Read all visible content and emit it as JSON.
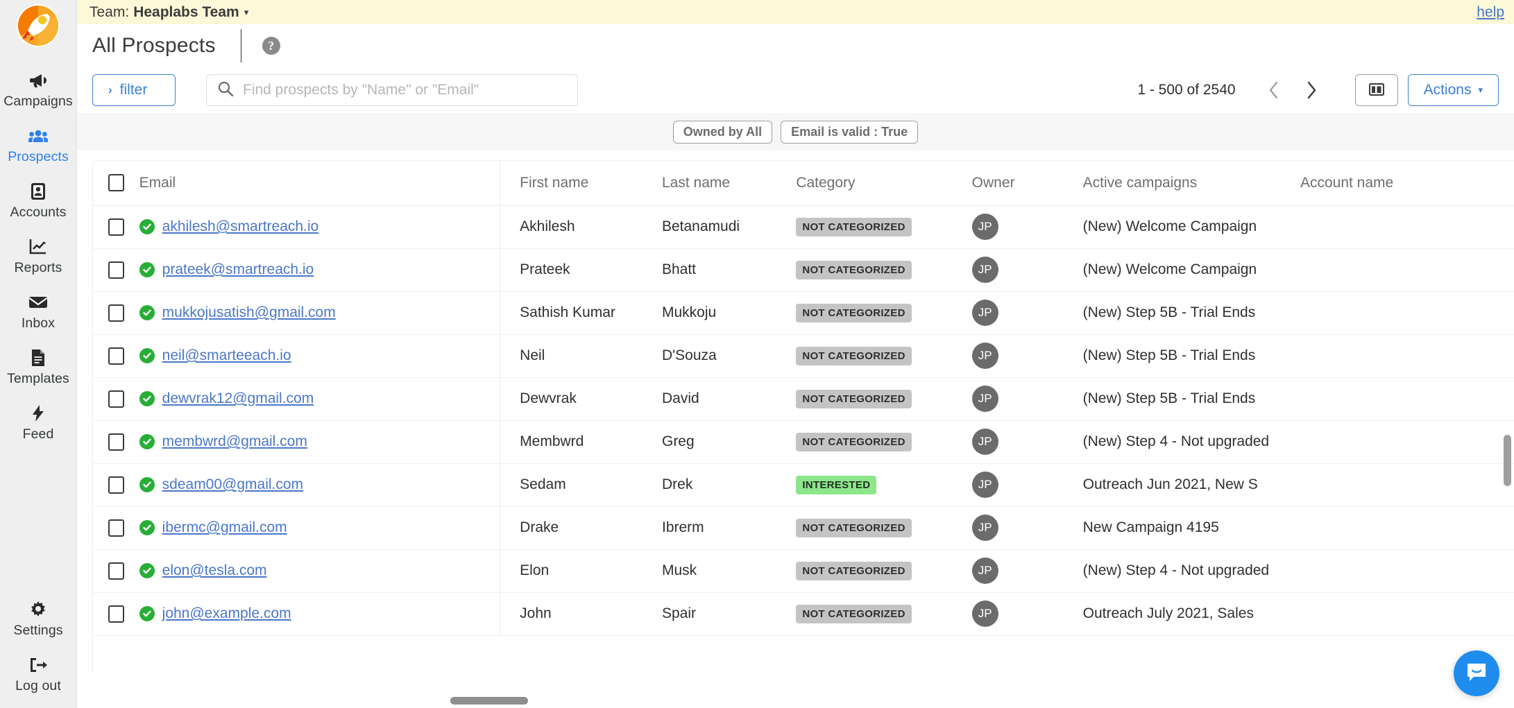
{
  "sidebar": {
    "logo_name": "rocket-logo",
    "top_items": [
      {
        "label": "Campaigns",
        "icon": "megaphone-icon",
        "active": false
      },
      {
        "label": "Prospects",
        "icon": "people-icon",
        "active": true
      },
      {
        "label": "Accounts",
        "icon": "id-card-icon",
        "active": false
      },
      {
        "label": "Reports",
        "icon": "chart-icon",
        "active": false
      },
      {
        "label": "Inbox",
        "icon": "envelope-icon",
        "active": false
      },
      {
        "label": "Templates",
        "icon": "document-icon",
        "active": false
      },
      {
        "label": "Feed",
        "icon": "bolt-icon",
        "active": false
      }
    ],
    "bottom_items": [
      {
        "label": "Settings",
        "icon": "gear-icon",
        "active": false
      },
      {
        "label": "Log out",
        "icon": "logout-icon",
        "active": false
      }
    ]
  },
  "teambar": {
    "prefix": "Team:",
    "team_name": "Heaplabs Team",
    "caret": "▾",
    "help_label": "help"
  },
  "header": {
    "title": "All Prospects",
    "help_icon_label": "?"
  },
  "toolbar": {
    "filter_label": "filter",
    "filter_chevron": "›",
    "search_placeholder": "Find prospects by \"Name\" or \"Email\"",
    "search_value": "",
    "pagination_text": "1 - 500 of 2540",
    "prev_label": "‹",
    "next_label": "›",
    "columns_button_name": "column-settings-button",
    "actions_label": "Actions",
    "actions_caret": "▾"
  },
  "filter_chips": [
    {
      "label": "Owned by All"
    },
    {
      "label": "Email is valid : True"
    }
  ],
  "table": {
    "columns": [
      "Email",
      "First name",
      "Last name",
      "Category",
      "Owner",
      "Active campaigns",
      "Account name"
    ],
    "rows": [
      {
        "email": "akhilesh@smartreach.io",
        "first_name": "Akhilesh",
        "last_name": "Betanamudi",
        "category": "NOT CATEGORIZED",
        "category_tone": "gray",
        "owner": "JP",
        "active_campaigns": "(New) Welcome Campaign",
        "account_name": ""
      },
      {
        "email": "prateek@smartreach.io",
        "first_name": "Prateek",
        "last_name": "Bhatt",
        "category": "NOT CATEGORIZED",
        "category_tone": "gray",
        "owner": "JP",
        "active_campaigns": "(New) Welcome Campaign",
        "account_name": ""
      },
      {
        "email": "mukkojusatish@gmail.com",
        "first_name": "Sathish Kumar",
        "last_name": "Mukkoju",
        "category": "NOT CATEGORIZED",
        "category_tone": "gray",
        "owner": "JP",
        "active_campaigns": "(New) Step 5B - Trial Ends",
        "account_name": ""
      },
      {
        "email": "neil@smarteeach.io",
        "first_name": "Neil",
        "last_name": "D'Souza",
        "category": "NOT CATEGORIZED",
        "category_tone": "gray",
        "owner": "JP",
        "active_campaigns": "(New) Step 5B - Trial Ends",
        "account_name": ""
      },
      {
        "email": "dewvrak12@gmail.com",
        "first_name": "Dewvrak",
        "last_name": "David",
        "category": "NOT CATEGORIZED",
        "category_tone": "gray",
        "owner": "JP",
        "active_campaigns": "(New) Step 5B - Trial Ends",
        "account_name": ""
      },
      {
        "email": "membwrd@gmail.com",
        "first_name": "Membwrd",
        "last_name": "Greg",
        "category": "NOT CATEGORIZED",
        "category_tone": "gray",
        "owner": "JP",
        "active_campaigns": "(New) Step 4 - Not upgraded",
        "account_name": ""
      },
      {
        "email": "sdeam00@gmail.com",
        "first_name": "Sedam",
        "last_name": "Drek",
        "category": "INTERESTED",
        "category_tone": "green",
        "owner": "JP",
        "active_campaigns": "Outreach Jun 2021, New S",
        "account_name": ""
      },
      {
        "email": "ibermc@gmail.com",
        "first_name": "Drake",
        "last_name": "Ibrerm",
        "category": "NOT CATEGORIZED",
        "category_tone": "gray",
        "owner": "JP",
        "active_campaigns": "New Campaign 4195",
        "account_name": ""
      },
      {
        "email": "elon@tesla.com",
        "first_name": "Elon",
        "last_name": "Musk",
        "category": "NOT CATEGORIZED",
        "category_tone": "gray",
        "owner": "JP",
        "active_campaigns": "(New) Step 4 - Not upgraded",
        "account_name": ""
      },
      {
        "email": "john@example.com",
        "first_name": "John",
        "last_name": "Spair",
        "category": "NOT CATEGORIZED",
        "category_tone": "gray",
        "owner": "JP",
        "active_campaigns": "Outreach July 2021, Sales",
        "account_name": ""
      }
    ]
  },
  "chat": {
    "icon": "chat-bubble-icon"
  },
  "colors": {
    "accent_blue": "#3b7fd4",
    "link_blue": "#4a77c8",
    "team_bar_yellow": "#fcf8d8",
    "valid_green": "#27ae36",
    "badge_green": "#8de68c",
    "badge_gray": "#c4c4c4",
    "avatar_gray": "#6b6b6b",
    "intercom_blue": "#1f8ded"
  }
}
